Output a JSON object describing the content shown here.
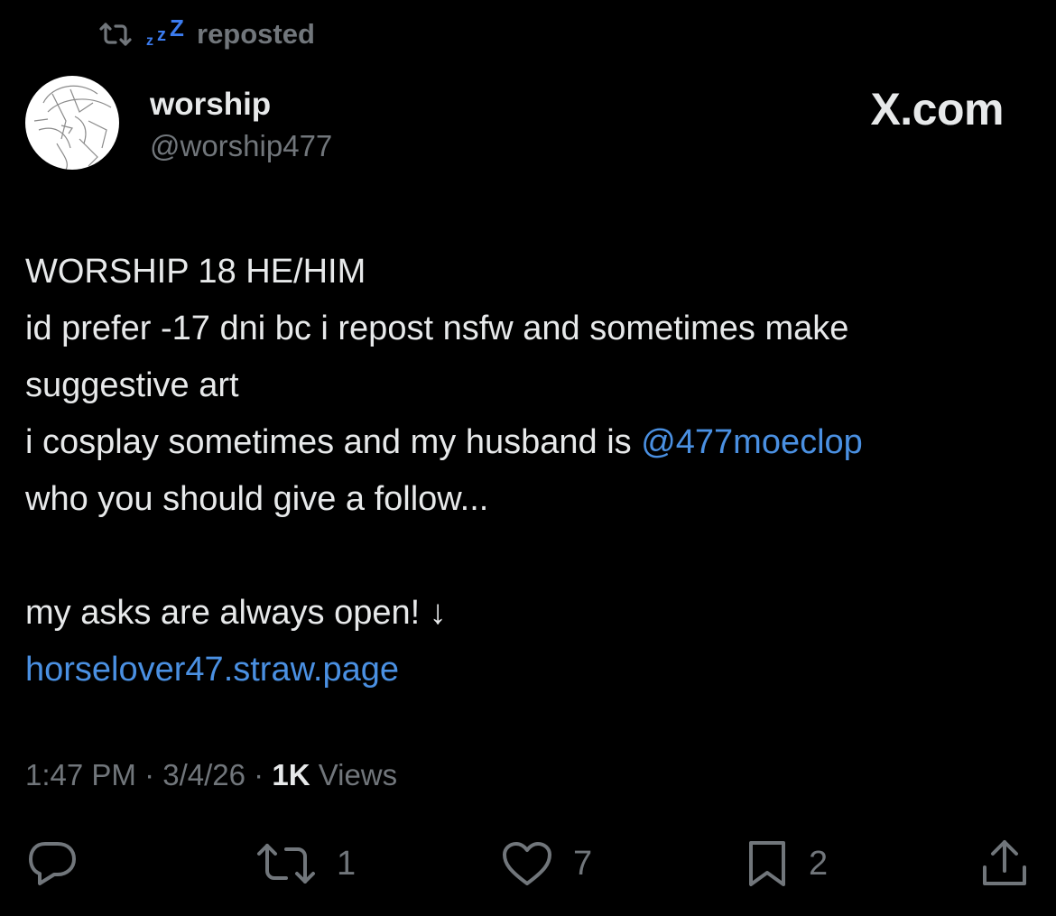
{
  "repost": {
    "user_label": "zzZ",
    "text": "reposted"
  },
  "profile": {
    "name": "worship",
    "handle": "@worship477"
  },
  "brand": "X.com",
  "bio": {
    "line1": "WORSHIP 18 HE/HIM",
    "line2": "id prefer -17 dni bc i repost nsfw and sometimes make",
    "line3": "suggestive art",
    "line4_prefix": "i cosplay sometimes and my husband is ",
    "line4_mention": "@477moeclop",
    "line5": "who you should give a follow...",
    "line6": "my asks are always open! ↓",
    "line7_link": "horselover47.straw.page"
  },
  "meta": {
    "time": "1:47 PM",
    "date": "3/4/26",
    "views_count": "1K",
    "views_label": "Views",
    "separator": "·"
  },
  "actions": {
    "reply_count": "",
    "repost_count": "1",
    "like_count": "7",
    "bookmark_count": "2"
  },
  "colors": {
    "background": "#000000",
    "text": "#e7e9ea",
    "muted": "#71767b",
    "link": "#4a90e2",
    "zzz": "#3b7cf0"
  }
}
